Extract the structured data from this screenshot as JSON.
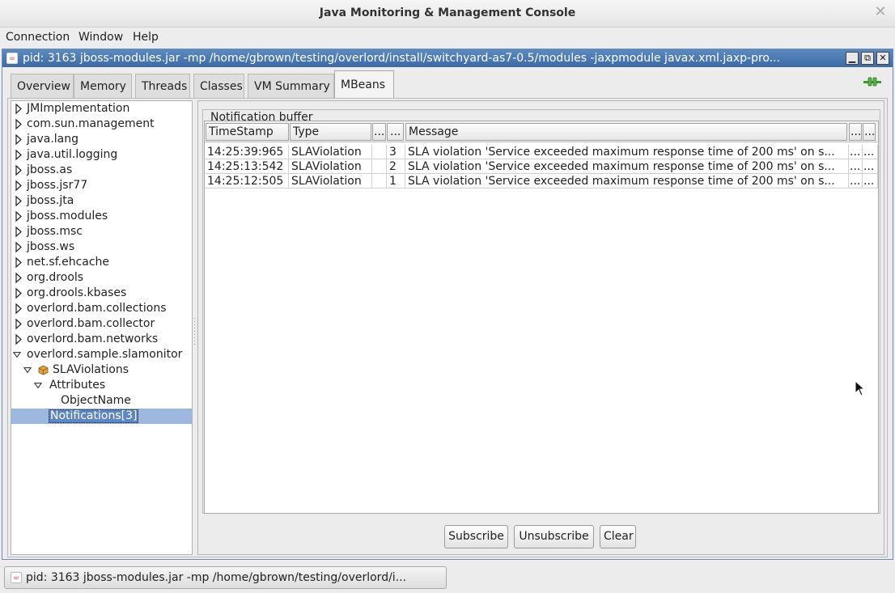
{
  "window": {
    "title": "Java Monitoring & Management Console",
    "close_glyph": "✕"
  },
  "menu": {
    "connection": "Connection",
    "window": "Window",
    "help": "Help"
  },
  "internal_frame": {
    "title": "pid: 3163 jboss-modules.jar -mp /home/gbrown/testing/overlord/install/switchyard-as7-0.5/modules -jaxpmodule javax.xml.jaxp-pro...",
    "minimize": "▁",
    "restore": "⧉",
    "close": "✕"
  },
  "tabs": {
    "overview": "Overview",
    "memory": "Memory",
    "threads": "Threads",
    "classes": "Classes",
    "vm_summary": "VM Summary",
    "mbeans": "MBeans"
  },
  "tree": {
    "items": [
      "JMImplementation",
      "com.sun.management",
      "java.lang",
      "java.util.logging",
      "jboss.as",
      "jboss.jsr77",
      "jboss.jta",
      "jboss.modules",
      "jboss.msc",
      "jboss.ws",
      "net.sf.ehcache",
      "org.drools",
      "org.drools.kbases",
      "overlord.bam.collections",
      "overlord.bam.collector",
      "overlord.bam.networks",
      "overlord.sample.slamonitor",
      "SLAViolations",
      "Attributes",
      "ObjectName",
      "Notifications[3]"
    ]
  },
  "notification": {
    "legend": "Notification buffer",
    "headers": [
      "TimeStamp",
      "Type",
      "...",
      "...",
      "Message",
      "...",
      "..."
    ],
    "rows": [
      [
        "14:25:39:965",
        "SLAViolation",
        "",
        "3",
        "SLA violation 'Service exceeded maximum response time of 200 ms' on s...",
        "...",
        "..."
      ],
      [
        "14:25:13:542",
        "SLAViolation",
        "",
        "2",
        "SLA violation 'Service exceeded maximum response time of 200 ms' on s...",
        "...",
        "..."
      ],
      [
        "14:25:12:505",
        "SLAViolation",
        "",
        "1",
        "SLA violation 'Service exceeded maximum response time of 200 ms' on s...",
        "...",
        "..."
      ]
    ]
  },
  "buttons": {
    "subscribe": "Subscribe",
    "unsubscribe": "Unsubscribe",
    "clear": "Clear"
  },
  "taskbar": {
    "label": "pid: 3163 jboss-modules.jar -mp /home/gbrown/testing/overlord/i..."
  },
  "icons": {
    "java_cup": "☕"
  },
  "colors": {
    "frame_title": "#4a78b4",
    "selection": "#9cb7e0",
    "connected_plug": "#3c9a2e"
  }
}
